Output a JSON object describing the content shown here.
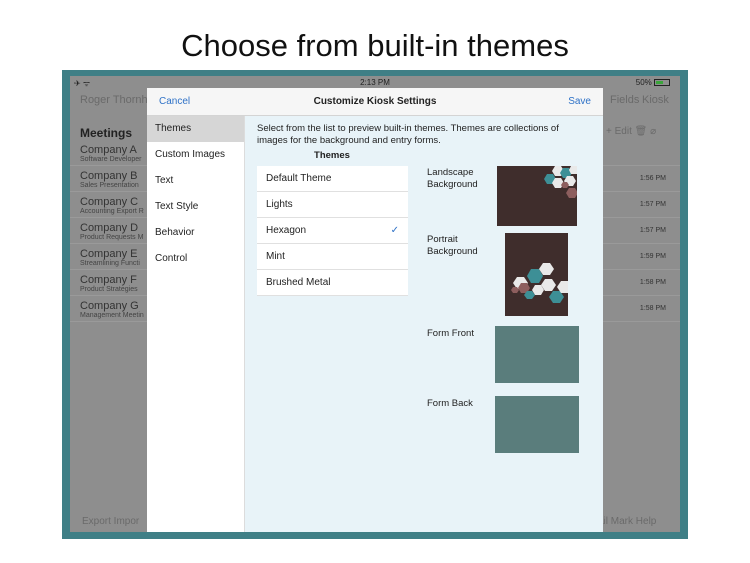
{
  "headline": "Choose from built-in themes",
  "status_bar": {
    "left": "✈ ᯤ",
    "time": "2:13 PM",
    "battery": "50%"
  },
  "background_app": {
    "nav_name": "Roger Thornh",
    "nav_fields": "Fields",
    "nav_kiosk": "Kiosk",
    "list_title": "Meetings",
    "edit": "Edit",
    "rows": [
      {
        "name": "Company A",
        "sub": "Software Developer",
        "time": ""
      },
      {
        "name": "Company B",
        "sub": "Sales Presentation",
        "time": "1:56 PM"
      },
      {
        "name": "Company C",
        "sub": "Accounting Export R",
        "time": "1:57 PM"
      },
      {
        "name": "Company D",
        "sub": "Product Requests M",
        "time": "1:57 PM"
      },
      {
        "name": "Company E",
        "sub": "Streamlining Functi",
        "time": "1:59 PM"
      },
      {
        "name": "Company F",
        "sub": "Product Strategies",
        "time": "1:58 PM"
      },
      {
        "name": "Company G",
        "sub": "Management Meetin",
        "time": "1:58 PM"
      }
    ],
    "bottom_left": "Export   Impor",
    "bottom_right": "ail   Mark   Help"
  },
  "modal": {
    "cancel": "Cancel",
    "title": "Customize Kiosk Settings",
    "save": "Save",
    "sidebar": [
      "Themes",
      "Custom Images",
      "Text",
      "Text Style",
      "Behavior",
      "Control"
    ],
    "description": "Select from the list to preview built-in themes.  Themes are collections of images for the background and entry forms.",
    "themes_label": "Themes",
    "themes": [
      "Default Theme",
      "Lights",
      "Hexagon",
      "Mint",
      "Brushed Metal"
    ],
    "selected_theme_index": 2,
    "check": "✓",
    "preview_labels": {
      "landscape": "Landscape\nBackground",
      "portrait": "Portrait\nBackground",
      "form_front": "Form Front",
      "form_back": "Form Back"
    },
    "colors": {
      "background_brown": "#3f2d2c",
      "hex_teal": "#3d8f96",
      "hex_white": "#e9e9e9",
      "hex_rose": "#8d5e5e",
      "form_teal": "#5a7d7c"
    }
  }
}
